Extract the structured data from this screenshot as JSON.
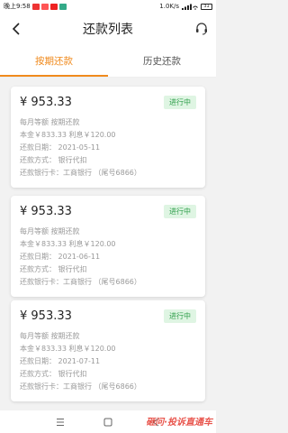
{
  "status_bar": {
    "time": "晚上9:58",
    "network_speed": "1.0K/s",
    "battery": "31"
  },
  "header": {
    "title": "还款列表"
  },
  "tabs": [
    {
      "label": "按期还款",
      "active": true
    },
    {
      "label": "历史还款",
      "active": false
    }
  ],
  "loans": [
    {
      "amount": "¥ 953.33",
      "status": "进行中",
      "plan": "每月等额 按期还款",
      "principal_interest": "本金￥833.33 利息￥120.00",
      "date": "还款日期：  2021-05-11",
      "method": "还款方式：  银行代扣",
      "card": "还款银行卡：工商银行 （尾号6866）"
    },
    {
      "amount": "¥ 953.33",
      "status": "进行中",
      "plan": "每月等额 按期还款",
      "principal_interest": "本金￥833.33 利息￥120.00",
      "date": "还款日期：  2021-06-11",
      "method": "还款方式：  银行代扣",
      "card": "还款银行卡：工商银行 （尾号6866）"
    },
    {
      "amount": "¥ 953.33",
      "status": "进行中",
      "plan": "每月等额 按期还款",
      "principal_interest": "本金￥833.33 利息￥120.00",
      "date": "还款日期：  2021-07-11",
      "method": "还款方式：  银行代扣",
      "card": "还款银行卡：工商银行 （尾号6866）"
    }
  ],
  "watermark": "砸问·投诉直通车",
  "colors": {
    "accent": "#f08a1d",
    "status_bg": "#dff5e3",
    "status_text": "#2e9e4a"
  }
}
